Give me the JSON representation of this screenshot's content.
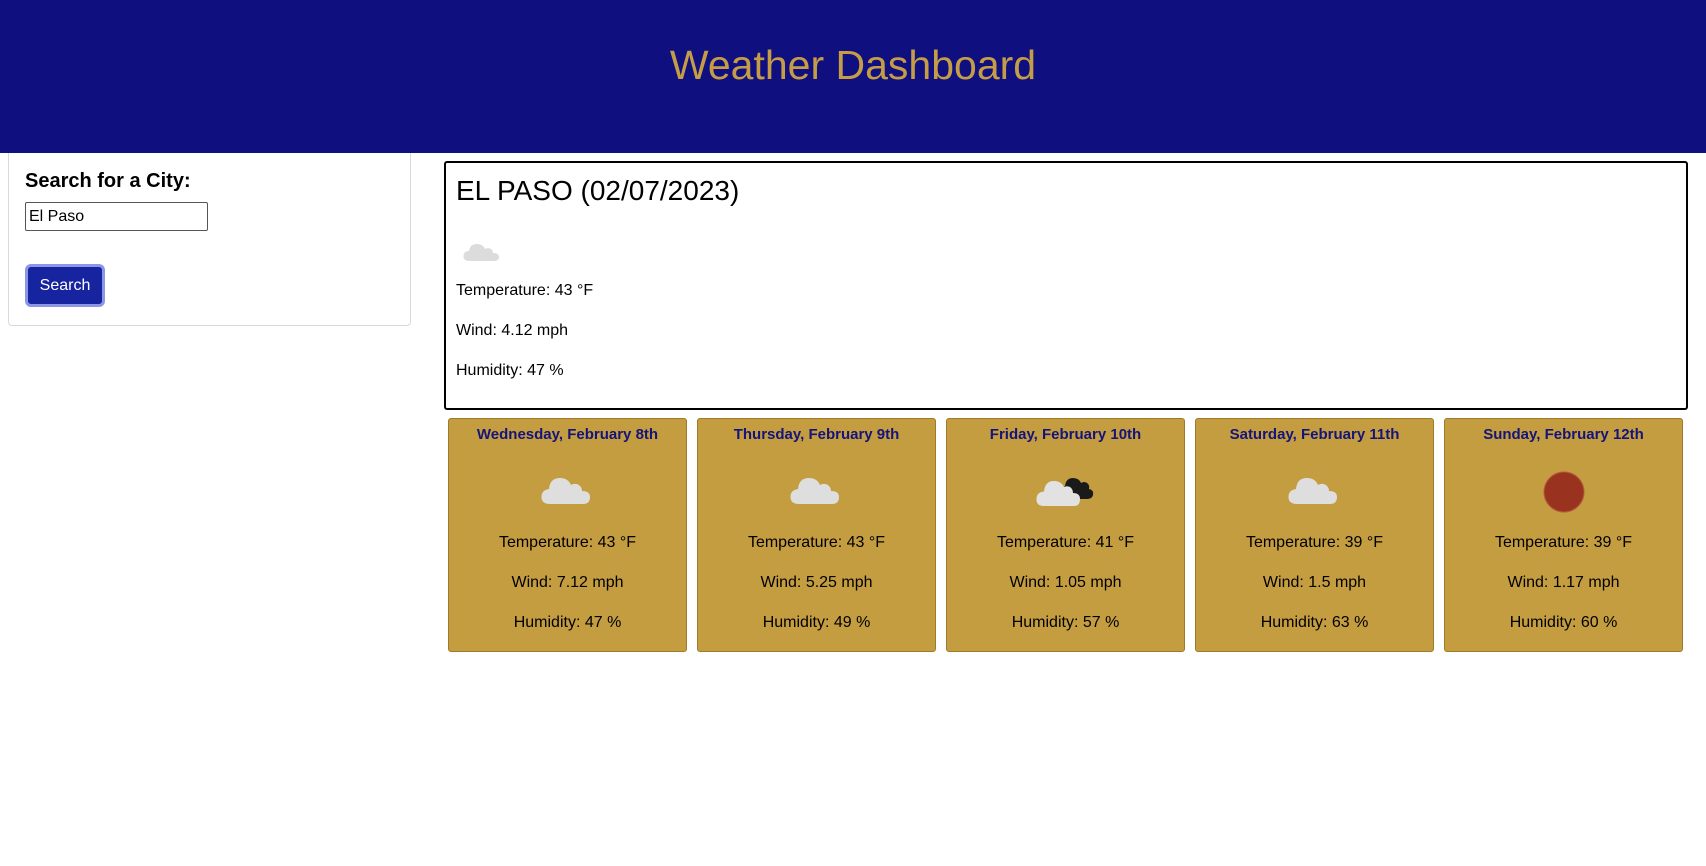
{
  "header": {
    "title": "Weather Dashboard"
  },
  "search": {
    "label": "Search for a City:",
    "value": "El Paso",
    "button_label": "Search"
  },
  "current": {
    "title": "EL PASO (02/07/2023)",
    "icon": "cloud-icon",
    "temperature": "Temperature: 43 °F",
    "wind": "Wind: 4.12 mph",
    "humidity": "Humidity: 47 %"
  },
  "forecast": [
    {
      "date": "Wednesday, February 8th",
      "icon": "cloud-icon",
      "temperature": "Temperature: 43 °F",
      "wind": "Wind: 7.12 mph",
      "humidity": "Humidity: 47 %"
    },
    {
      "date": "Thursday, February 9th",
      "icon": "cloud-icon",
      "temperature": "Temperature: 43 °F",
      "wind": "Wind: 5.25 mph",
      "humidity": "Humidity: 49 %"
    },
    {
      "date": "Friday, February 10th",
      "icon": "broken-clouds-icon",
      "temperature": "Temperature: 41 °F",
      "wind": "Wind: 1.05 mph",
      "humidity": "Humidity: 57 %"
    },
    {
      "date": "Saturday, February 11th",
      "icon": "cloud-icon",
      "temperature": "Temperature: 39 °F",
      "wind": "Wind: 1.5 mph",
      "humidity": "Humidity: 63 %"
    },
    {
      "date": "Sunday, February 12th",
      "icon": "clear-sky-icon",
      "temperature": "Temperature: 39 °F",
      "wind": "Wind: 1.17 mph",
      "humidity": "Humidity: 60 %"
    }
  ],
  "colors": {
    "header_bg": "#0f0f80",
    "title_gold": "#c49d46",
    "card_bg": "#c49d41",
    "card_date": "#14147a",
    "button_bg": "#1624a0",
    "sun": "#9a3220"
  }
}
